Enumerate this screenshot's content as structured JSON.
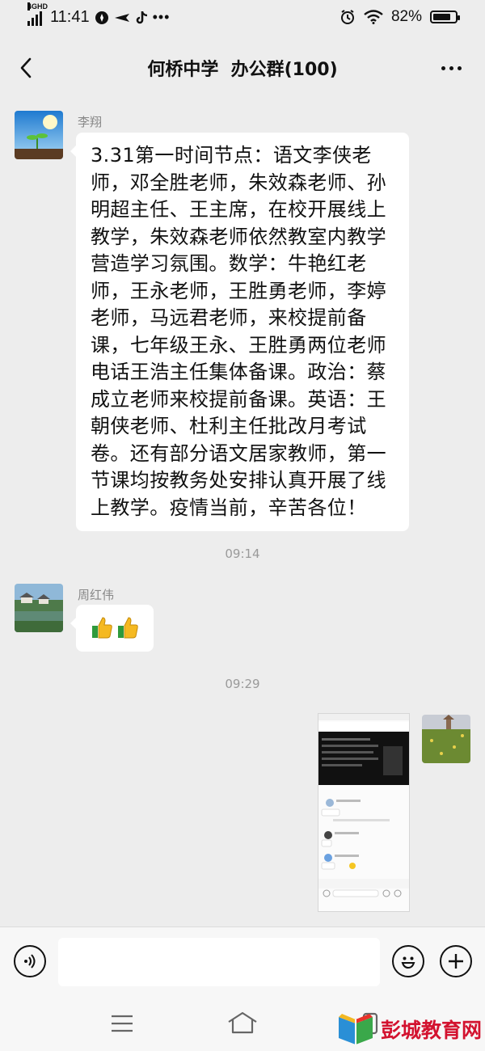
{
  "status_bar": {
    "network": "4GHD",
    "time": "11:41",
    "icons": [
      "compass-icon",
      "airplane-mode-icon",
      "tiktok-icon",
      "more-dots-icon"
    ],
    "alarm_icon": "alarm-icon",
    "wifi_icon": "wifi-icon",
    "battery": "82%",
    "battery_level": 0.82
  },
  "header": {
    "title": "何桥中学  办公群(100)",
    "back_icon": "back-arrow-icon",
    "more_icon": "more-icon"
  },
  "messages": [
    {
      "sender": "李翔",
      "avatar": "sprout-sky-avatar",
      "text": "3.31第一时间节点：语文李侠老师，邓全胜老师，朱效森老师、孙明超主任、王主席，在校开展线上教学，朱效森老师依然教室内教学营造学习氛围。数学：牛艳红老师，王永老师，王胜勇老师，李婷老师，马远君老师，来校提前备课，七年级王永、王胜勇两位老师电话王浩主任集体备课。政治：蔡成立老师来校提前备课。英语：王朝侠老师、杜利主任批改月考试卷。还有部分语文居家教师，第一节课均按教务处安排认真开展了线上教学。疫情当前，辛苦各位！"
    },
    {
      "timestamp": "09:14"
    },
    {
      "sender": "周红伟",
      "avatar": "lake-village-avatar",
      "emoji": [
        "thumbs-up",
        "thumbs-up"
      ]
    },
    {
      "timestamp": "09:29"
    },
    {
      "sender_self": true,
      "avatar": "field-avatar",
      "image": "screenshot-thumbnail"
    }
  ],
  "input_bar": {
    "voice_icon": "voice-icon",
    "emoji_icon": "emoji-icon",
    "plus_icon": "plus-icon",
    "input_value": ""
  },
  "system_nav": {
    "menu_icon": "menu-icon",
    "home_icon": "home-icon",
    "back_icon": "back-icon"
  },
  "watermark": {
    "text": "彭城教育网"
  },
  "colors": {
    "background": "#ededed",
    "bubble": "#ffffff",
    "watermark": "#d3122f"
  }
}
